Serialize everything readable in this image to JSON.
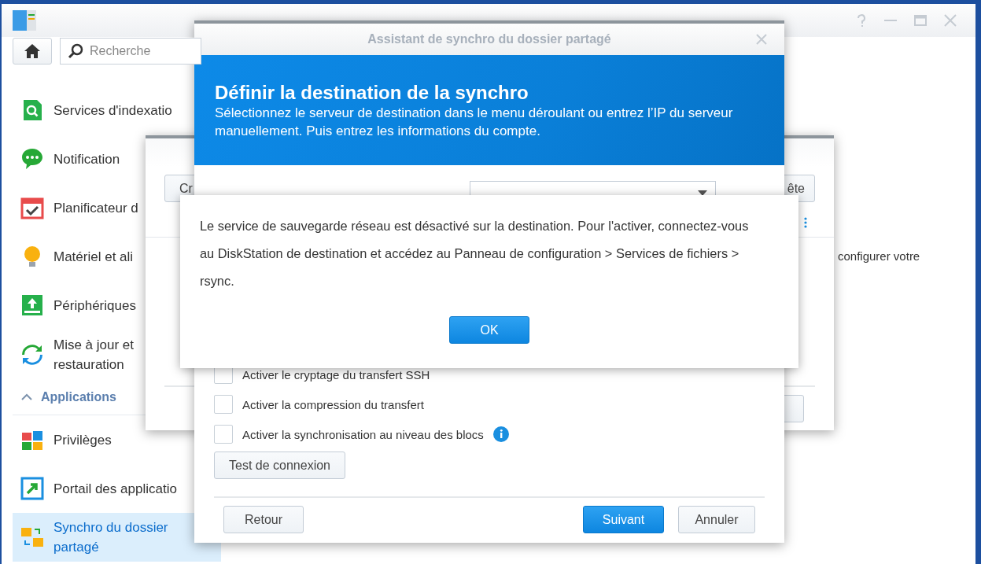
{
  "control_panel": {
    "search": {
      "placeholder": "Recherche"
    },
    "sidebar": [
      {
        "kind": "item",
        "label": "Services d'indexatio",
        "selected": false
      },
      {
        "kind": "item",
        "label": "Notification",
        "selected": false
      },
      {
        "kind": "item",
        "label": "Planificateur d",
        "selected": false
      },
      {
        "kind": "item",
        "label": "Matériel et ali",
        "selected": false
      },
      {
        "kind": "item",
        "label": "Périphériques",
        "selected": false
      },
      {
        "kind": "item",
        "label": "Mise à jour et restauration",
        "selected": false
      },
      {
        "kind": "section",
        "label": "Applications",
        "expanded": true
      },
      {
        "kind": "item",
        "label": "Privilèges",
        "selected": false
      },
      {
        "kind": "item",
        "label": "Portail des applicatio",
        "selected": false
      },
      {
        "kind": "item",
        "label": "Synchro du dossier partagé",
        "selected": true
      }
    ],
    "content_text": "configurer votre"
  },
  "background_window": {
    "left_button": "Cr",
    "right_button": "ête"
  },
  "wizard": {
    "title": "Assistant de synchro du dossier partagé",
    "heading": "Définir la destination de la synchro",
    "subtitle": "Sélectionnez le serveur de destination dans le menu déroulant ou entrez l’IP du serveur manuellement. Puis entrez les informations du compte.",
    "options": [
      {
        "label": "Activer le cryptage du transfert SSH",
        "checked": false
      },
      {
        "label": "Activer la compression du transfert",
        "checked": false
      },
      {
        "label": "Activer la synchronisation au niveau des blocs",
        "checked": false,
        "info": true
      }
    ],
    "test_button": "Test de connexion",
    "back_button": "Retour",
    "next_button": "Suivant",
    "cancel_button": "Annuler"
  },
  "alert": {
    "message": "Le service de sauvegarde réseau est désactivé sur la destination. Pour l'activer, connectez-vous au DiskStation de destination et accédez au Panneau de configuration > Services de fichiers > rsync.",
    "ok_button": "OK"
  }
}
